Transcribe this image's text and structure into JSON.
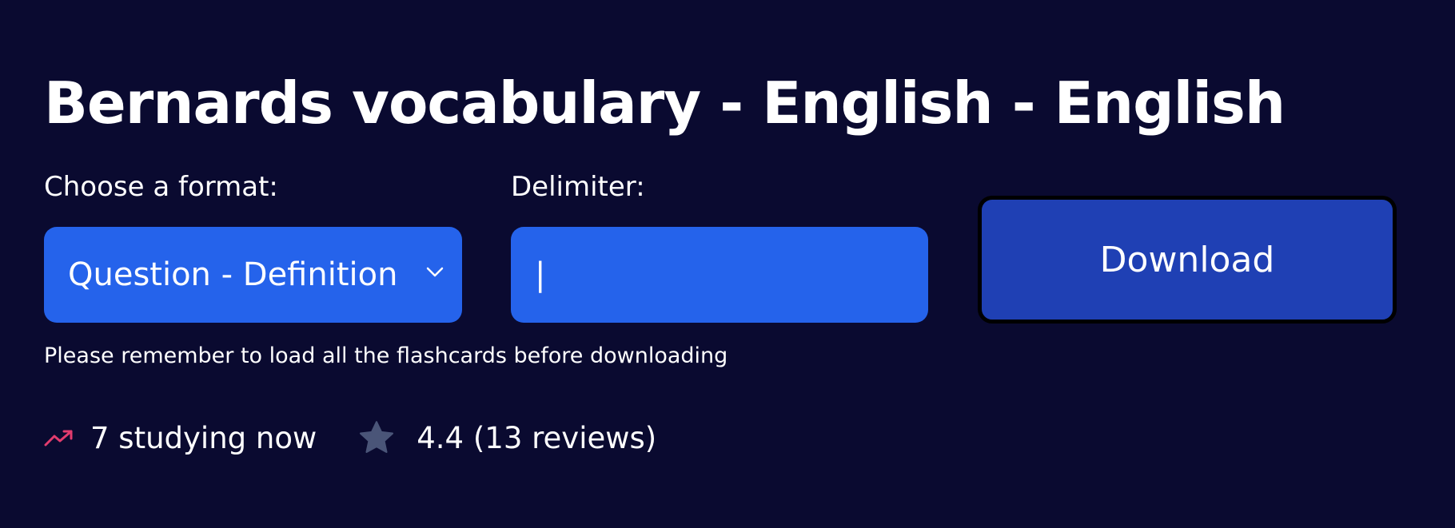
{
  "title": "Bernards vocabulary - English - English",
  "format": {
    "label": "Choose a format:",
    "selected": "Question - Definition"
  },
  "delimiter": {
    "label": "Delimiter:",
    "value": "|"
  },
  "download_label": "Download",
  "reminder": "Please remember to load all the flashcards before downloading",
  "stats": {
    "studying": "7 studying now",
    "rating": "4.4 (13 reviews)"
  },
  "colors": {
    "background": "#0a0a30",
    "field": "#2563eb",
    "button": "#1f40b4",
    "trend": "#e23c6e",
    "star": "#4a5578"
  },
  "icons": [
    "chevron-down-icon",
    "trending-up-icon",
    "star-icon"
  ]
}
